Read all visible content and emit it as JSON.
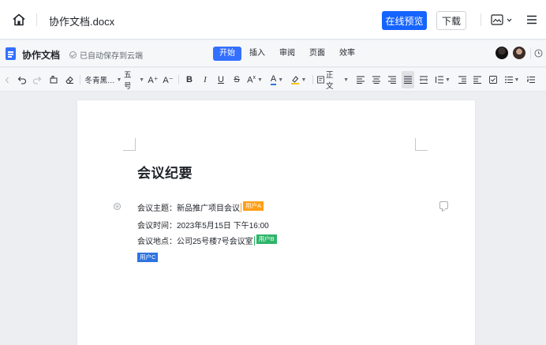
{
  "topbar": {
    "file_name": "协作文档.docx",
    "preview_label": "在线预览",
    "download_label": "下载"
  },
  "docbar": {
    "title": "协作文档",
    "save_status": "已自动保存到云端",
    "tabs": [
      {
        "label": "开始",
        "active": true
      },
      {
        "label": "插入",
        "active": false
      },
      {
        "label": "审阅",
        "active": false
      },
      {
        "label": "页面",
        "active": false
      },
      {
        "label": "效率",
        "active": false
      }
    ]
  },
  "toolbar": {
    "font_name": "冬青黑…",
    "font_size": "五号",
    "grow_label": "A⁺",
    "shrink_label": "A⁻",
    "bold": "B",
    "italic": "I",
    "underline": "U",
    "strike": "S",
    "style_label": "正文"
  },
  "document": {
    "heading": "会议纪要",
    "lines": [
      "会议主题：新品推广项目会议",
      "会议时间：2023年5月15日 下午16:00",
      "会议地点：公司25号楼7号会议室"
    ],
    "cursors": [
      {
        "user": "用户A",
        "color": "#ff9f1a"
      },
      {
        "user": "用户B",
        "color": "#2fb56a"
      },
      {
        "user": "用户C",
        "color": "#2f73e0"
      }
    ]
  },
  "colors": {
    "primary": "#1664ff",
    "tab_active": "#3370ff"
  }
}
